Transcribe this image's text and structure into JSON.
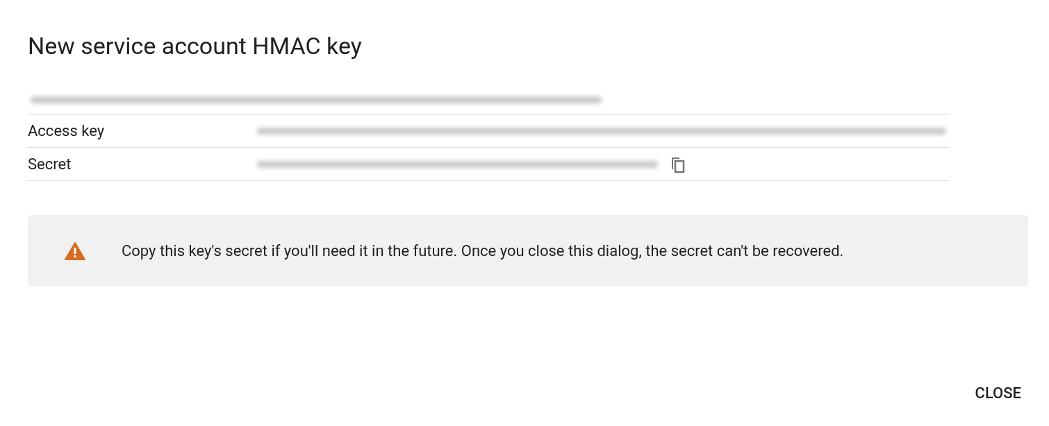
{
  "dialog": {
    "title": "New service account HMAC key",
    "account": {
      "kind": "redacted"
    },
    "rows": [
      {
        "label": "Access key",
        "value": {
          "kind": "redacted"
        },
        "copy_button": false
      },
      {
        "label": "Secret",
        "value": {
          "kind": "redacted"
        },
        "copy_button": true
      }
    ],
    "warning": {
      "kind": "warning",
      "text": "Copy this key's secret if you'll need it in the future. Once you close this dialog, the secret can't be recovered."
    },
    "buttons": [
      "CLOSE"
    ]
  }
}
